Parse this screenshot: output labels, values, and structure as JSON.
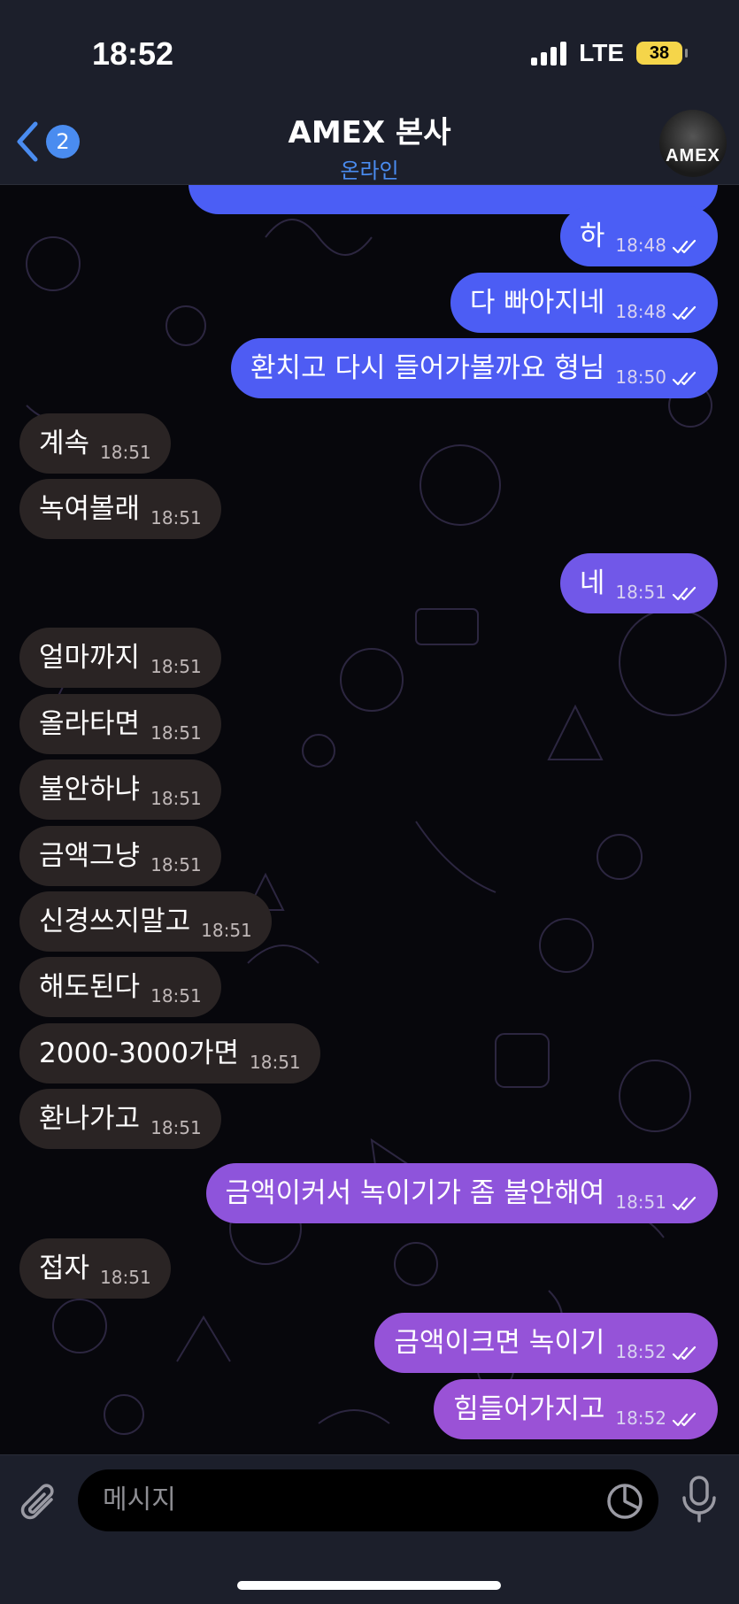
{
  "status_bar": {
    "time": "18:52",
    "network": "LTE",
    "battery": "38"
  },
  "header": {
    "back_badge": "2",
    "title": "AMEX 본사",
    "subtitle": "온라인",
    "avatar_text": "AMEX"
  },
  "messages": [
    {
      "dir": "out",
      "text": "하",
      "time": "18:48"
    },
    {
      "dir": "out",
      "text": "다 빠아지네",
      "time": "18:48"
    },
    {
      "dir": "out",
      "text": "환치고 다시 들어가볼까요 형님",
      "time": "18:50"
    },
    {
      "dir": "in",
      "text": "계속",
      "time": "18:51"
    },
    {
      "dir": "in",
      "text": "녹여볼래",
      "time": "18:51"
    },
    {
      "dir": "out",
      "text": "네",
      "time": "18:51"
    },
    {
      "dir": "in",
      "text": "얼마까지",
      "time": "18:51"
    },
    {
      "dir": "in",
      "text": "올라타면",
      "time": "18:51"
    },
    {
      "dir": "in",
      "text": "불안하냐",
      "time": "18:51"
    },
    {
      "dir": "in",
      "text": "금액그냥",
      "time": "18:51"
    },
    {
      "dir": "in",
      "text": "신경쓰지말고",
      "time": "18:51"
    },
    {
      "dir": "in",
      "text": "해도된다",
      "time": "18:51"
    },
    {
      "dir": "in",
      "text": "2000-3000가면",
      "time": "18:51"
    },
    {
      "dir": "in",
      "text": "환나가고",
      "time": "18:51"
    },
    {
      "dir": "out",
      "text": "금액이커서 녹이기가 좀 불안해여",
      "time": "18:51"
    },
    {
      "dir": "in",
      "text": "접자",
      "time": "18:51"
    },
    {
      "dir": "out",
      "text": "금액이크면 녹이기",
      "time": "18:52"
    },
    {
      "dir": "out",
      "text": "힘들어가지고",
      "time": "18:52"
    }
  ],
  "composer": {
    "placeholder": "메시지"
  },
  "colors": {
    "accent": "#4a8cf0",
    "incoming_bubble": "#2a2424",
    "outgoing_bubble_top": "#4b5ef5",
    "outgoing_bubble_bottom": "#9a52d6",
    "header_bg": "#1c1f2b"
  },
  "icons": [
    "back-chevron-icon",
    "attachment-clip-icon",
    "sticker-icon",
    "microphone-icon",
    "double-check-icon"
  ]
}
